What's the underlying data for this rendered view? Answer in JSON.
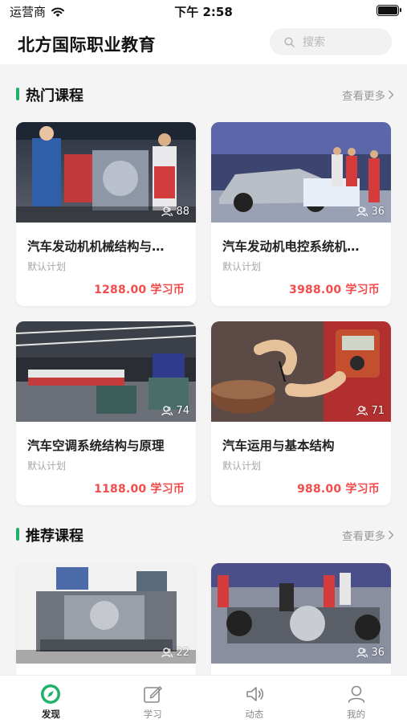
{
  "status": {
    "carrier": "运营商",
    "time": "下午 2:58"
  },
  "header": {
    "title": "北方国际职业教育",
    "search_placeholder": "搜索"
  },
  "sections": {
    "hot": {
      "title": "热门课程",
      "more": "查看更多"
    },
    "recommended": {
      "title": "推荐课程",
      "more": "查看更多"
    }
  },
  "hot_courses": [
    {
      "title": "汽车发动机机械结构与…",
      "plan": "默认计划",
      "price": "1288.00 学习币",
      "learners": "88"
    },
    {
      "title": "汽车发动机电控系统机…",
      "plan": "默认计划",
      "price": "3988.00 学习币",
      "learners": "36"
    },
    {
      "title": "汽车空调系统结构与原理",
      "plan": "默认计划",
      "price": "1188.00 学习币",
      "learners": "74"
    },
    {
      "title": "汽车运用与基本结构",
      "plan": "默认计划",
      "price": "988.00 学习币",
      "learners": "71"
    }
  ],
  "recommended_courses": [
    {
      "learners": "22"
    },
    {
      "learners": "36"
    }
  ],
  "tabbar": {
    "items": [
      {
        "label": "发现",
        "icon": "compass-icon",
        "active": true
      },
      {
        "label": "学习",
        "icon": "edit-icon",
        "active": false
      },
      {
        "label": "动态",
        "icon": "speaker-icon",
        "active": false
      },
      {
        "label": "我的",
        "icon": "user-icon",
        "active": false
      }
    ]
  },
  "colors": {
    "accent": "#20b26b",
    "price": "#f24b4b",
    "background": "#f4f4f4"
  }
}
